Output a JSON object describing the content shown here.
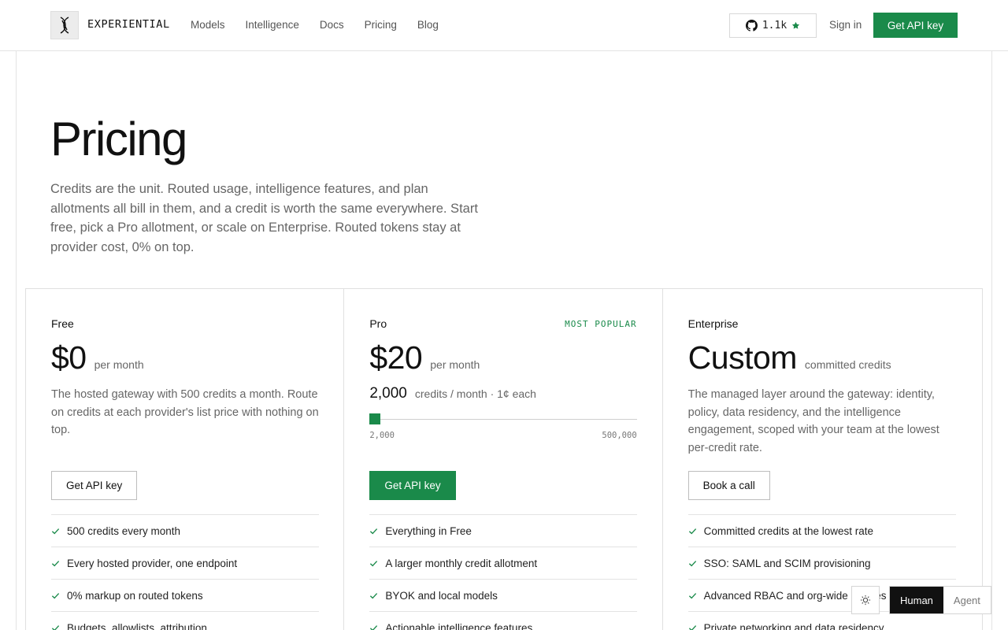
{
  "header": {
    "brand": "EXPERIENTIAL",
    "nav": [
      "Models",
      "Intelligence",
      "Docs",
      "Pricing",
      "Blog"
    ],
    "github_stars": "1.1k",
    "sign_in": "Sign in",
    "cta": "Get API key",
    "icons": [
      "logo-icon",
      "github-icon",
      "star-icon"
    ]
  },
  "hero": {
    "title": "Pricing",
    "description": "Credits are the unit. Routed usage, intelligence features, and plan allotments all bill in them, and a credit is worth the same everywhere. Start free, pick a Pro allotment, or scale on Enterprise. Routed tokens stay at provider cost, 0% on top."
  },
  "plans": {
    "free": {
      "name": "Free",
      "price": "$0",
      "price_unit": "per month",
      "description": "The hosted gateway with 500 credits a month. Route on credits at each provider's list price with nothing on top.",
      "button": "Get API key",
      "features": [
        "500 credits every month",
        "Every hosted provider, one endpoint",
        "0% markup on routed tokens",
        "Budgets, allowlists, attribution"
      ]
    },
    "pro": {
      "name": "Pro",
      "badge": "MOST POPULAR",
      "price": "$20",
      "price_unit": "per month",
      "credits": "2,000",
      "credits_meta": "credits / month · 1¢ each",
      "slider_min": "2,000",
      "slider_max": "500,000",
      "slider_value": 2000,
      "button": "Get API key",
      "features": [
        "Everything in Free",
        "A larger monthly credit allotment",
        "BYOK and local models",
        "Actionable intelligence features"
      ]
    },
    "enterprise": {
      "name": "Enterprise",
      "price": "Custom",
      "price_unit": "committed credits",
      "description": "The managed layer around the gateway: identity, policy, data residency, and the intelligence engagement, scoped with your team at the lowest per-credit rate.",
      "button": "Book a call",
      "features": [
        "Committed credits at the lowest rate",
        "SSO: SAML and SCIM provisioning",
        "Advanced RBAC and org-wide policies",
        "Private networking and data residency"
      ]
    }
  },
  "controls": {
    "theme_icon": "sun-icon",
    "mode_human": "Human",
    "mode_agent": "Agent"
  },
  "colors": {
    "accent": "#1a8a4a",
    "text": "#111111",
    "muted": "#666666",
    "border": "#e3e3e3"
  }
}
